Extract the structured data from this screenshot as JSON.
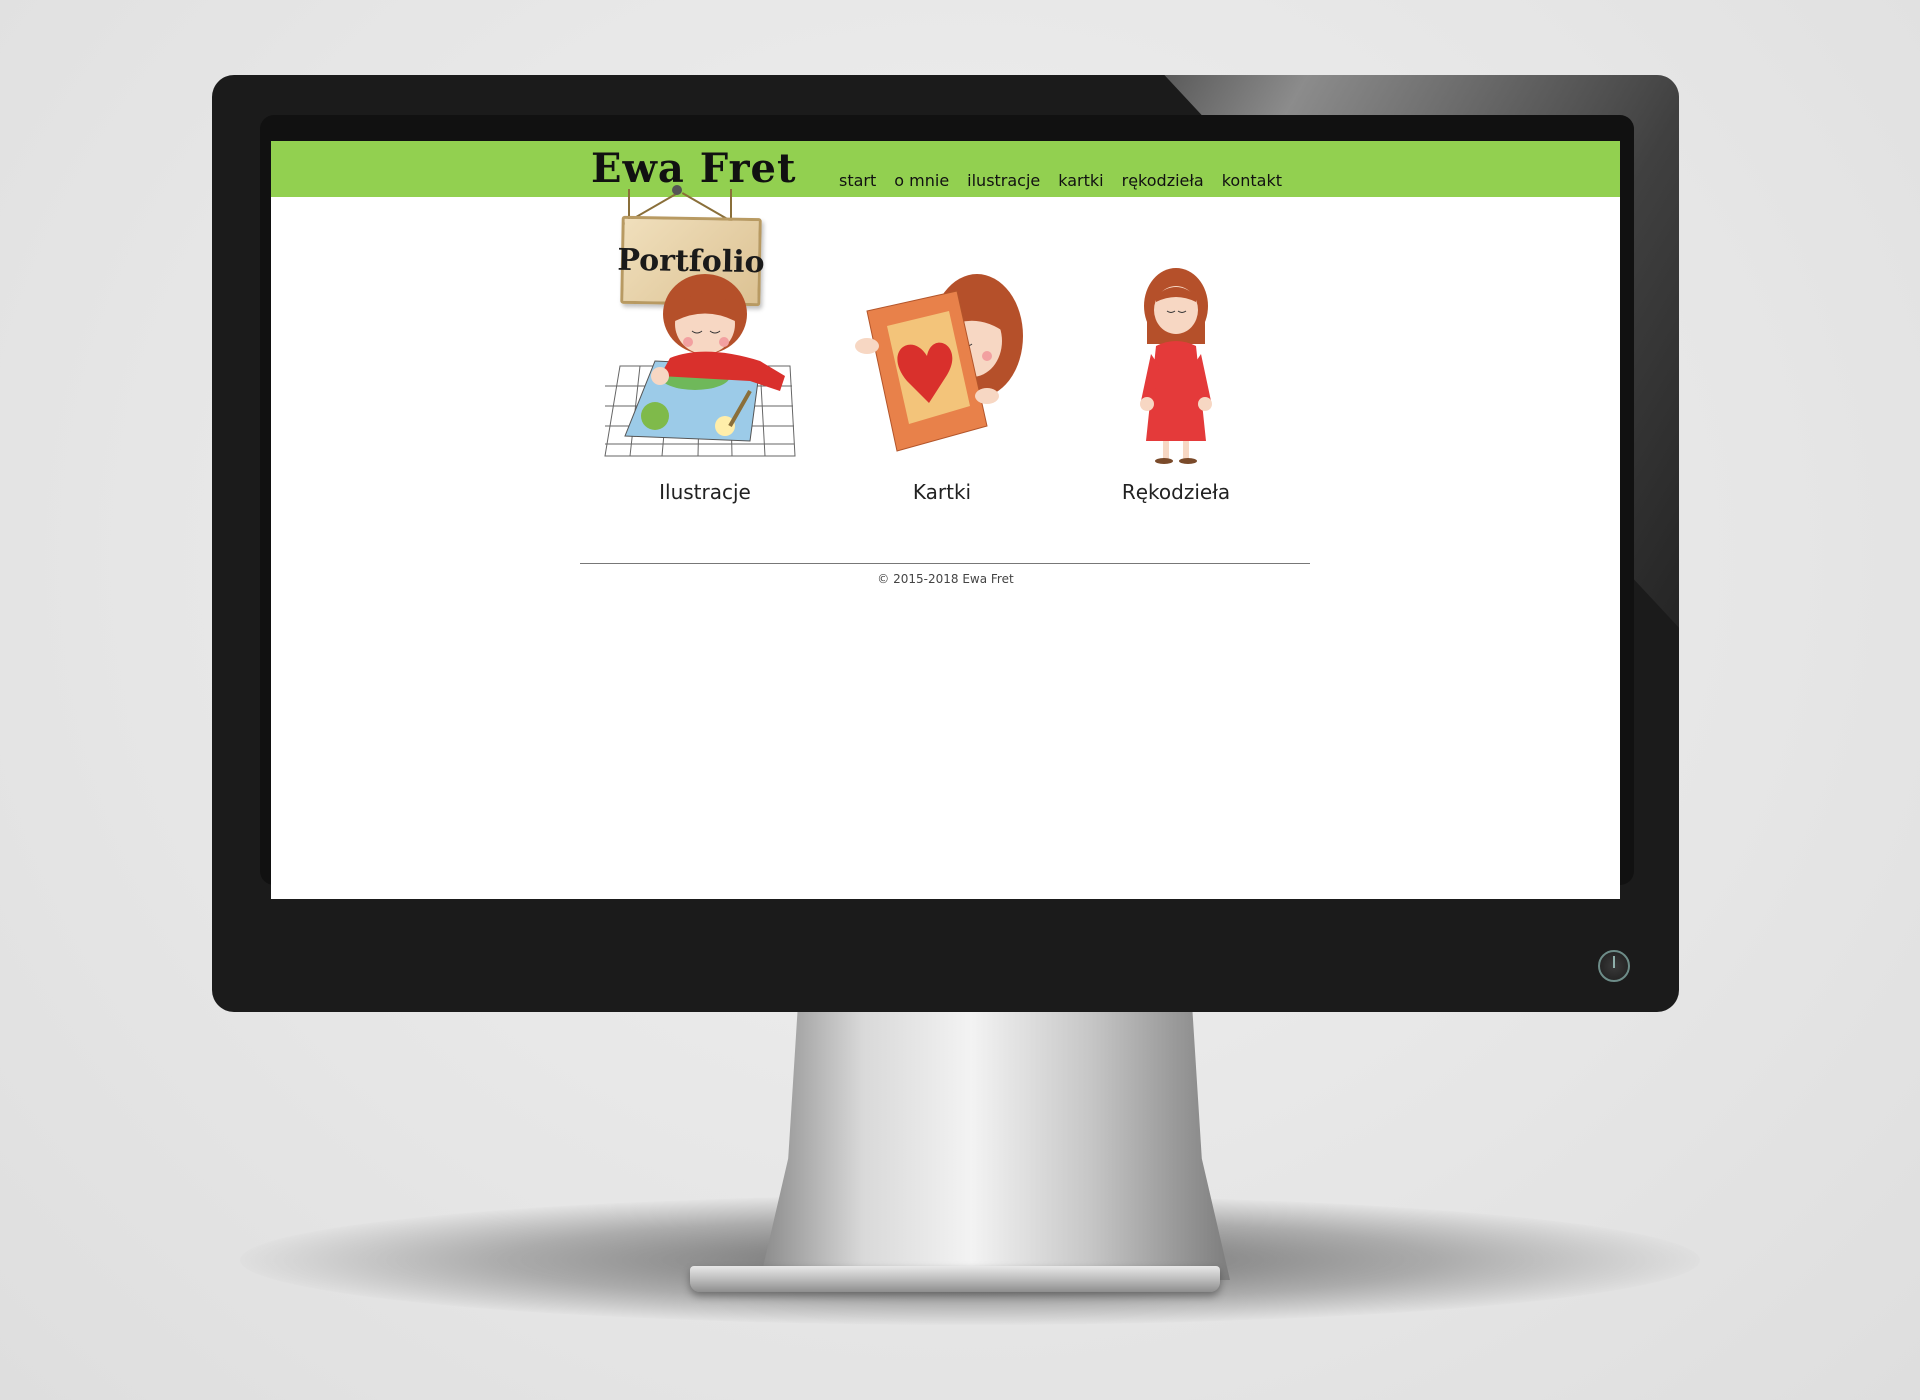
{
  "site": {
    "brand": "Ewa Fret",
    "nav": [
      "start",
      "o mnie",
      "ilustracje",
      "kartki",
      "rękodzieła",
      "kontakt"
    ],
    "sign": "Portfolio",
    "tiles": [
      "Ilustracje",
      "Kartki",
      "Rękodzieła"
    ],
    "copyright": "© 2015-2018 Ewa Fret"
  },
  "colors": {
    "header": "#92d050",
    "bezel": "#1b1b1b",
    "screen": "#ffffff"
  },
  "icons": {
    "tile_1": "girl-drawing-illustration",
    "tile_2": "girl-holding-heart-card-illustration",
    "tile_3": "girl-red-dress-illustration",
    "power": "power-icon"
  }
}
